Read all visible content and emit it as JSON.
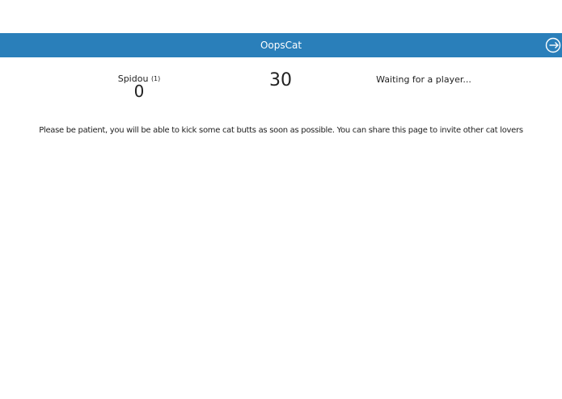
{
  "header": {
    "title": "OopsCat",
    "bg_color": "#2a7fba",
    "logout_icon": "logout-icon"
  },
  "scoreboard": {
    "player": {
      "name": "Spidou",
      "rank": "(1)",
      "score": "0"
    },
    "timer": "30",
    "opponent_status": "Waiting for a player..."
  },
  "message": "Please be patient, you will be able to kick some cat butts as soon as possible. You can share this page to invite other cat lovers"
}
